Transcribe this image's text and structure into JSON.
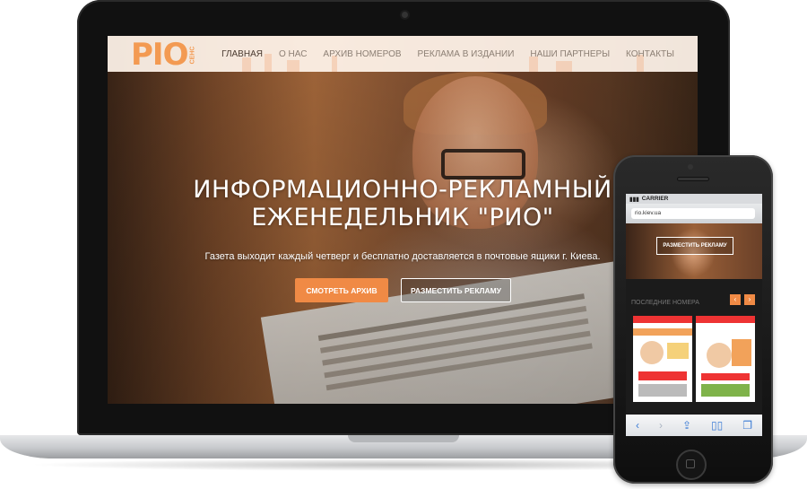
{
  "desktop_site": {
    "logo": {
      "main": "PIO",
      "small": "СЕНС"
    },
    "nav": [
      {
        "label": "ГЛАВНАЯ",
        "active": true
      },
      {
        "label": "О НАС",
        "active": false
      },
      {
        "label": "АРХИВ НОМЕРОВ",
        "active": false
      },
      {
        "label": "РЕКЛАМА В ИЗДАНИИ",
        "active": false
      },
      {
        "label": "НАШИ ПАРТНЕРЫ",
        "active": false
      },
      {
        "label": "КОНТАКТЫ",
        "active": false
      }
    ],
    "hero": {
      "title_line1": "ИНФОРМАЦИОННО-РЕКЛАМНЫЙ",
      "title_line2": "ЕЖЕНЕДЕЛЬНИК \"РИО\"",
      "subtitle": "Газета выходит каждый четверг и бесплатно доставляется в почтовые ящики г. Киева.",
      "primary_button": "СМОТРЕТЬ АРХИВ",
      "secondary_button": "РАЗМЕСТИТЬ РЕКЛАМУ"
    }
  },
  "mobile_site": {
    "carrier": "CARRIER",
    "url": "rio.kiev.ua",
    "hero_button": "РАЗМЕСТИТЬ РЕКЛАМУ",
    "section_title": "ПОСЛЕДНИЕ НОМЕРА",
    "toolbar_icons": [
      "back-icon",
      "forward-icon",
      "share-icon",
      "bookmarks-icon",
      "tabs-icon"
    ]
  },
  "colors": {
    "accent": "#f08a45",
    "logo": "#f39a52",
    "header_bg": "#fff4eb"
  }
}
